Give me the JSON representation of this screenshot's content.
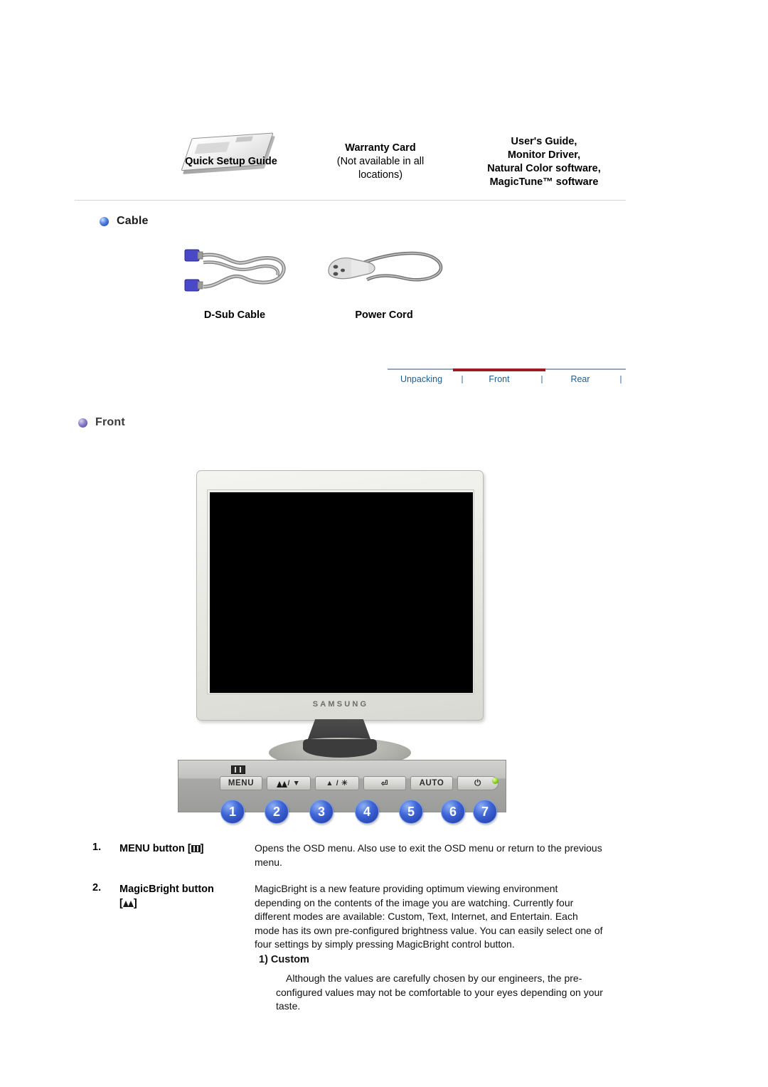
{
  "accessories": {
    "items": [
      {
        "caption": "Quick Setup Guide",
        "icon": "booklet-icon"
      },
      {
        "caption_line1": "Warranty Card",
        "caption_line2": "(Not available in all",
        "caption_line3": "locations)"
      },
      {
        "line1": "User's Guide,",
        "line2": "Monitor Driver,",
        "line3": "Natural Color software,",
        "line4": "MagicTune™ software"
      }
    ]
  },
  "cable_section": {
    "heading": "Cable",
    "bullet_color": "#3d64d6",
    "items": [
      {
        "caption": "D-Sub Cable",
        "icon": "dsub-cable-icon"
      },
      {
        "caption": "Power Cord",
        "icon": "power-cord-icon"
      }
    ]
  },
  "nav": {
    "active_color": "#9c1b20",
    "line_color": "#8fa6c4",
    "tabs": [
      {
        "label": "Unpacking",
        "active": false
      },
      {
        "label": "Front",
        "active": true
      },
      {
        "label": "Rear",
        "active": false
      }
    ]
  },
  "front_section": {
    "heading": "Front",
    "bullet_color": "#8a7fc8",
    "monitor": {
      "brand": "SAMSUNG"
    },
    "control_panel": {
      "buttons": [
        {
          "n": "1",
          "label": "MENU"
        },
        {
          "n": "2",
          "label": "/ ▼"
        },
        {
          "n": "3",
          "label": "▲ / ☀"
        },
        {
          "n": "4",
          "label": "⏎"
        },
        {
          "n": "5",
          "label": "AUTO"
        },
        {
          "n": "6",
          "label": "⏻"
        },
        {
          "n": "7",
          "label": ""
        }
      ],
      "numbers": [
        "1",
        "2",
        "3",
        "4",
        "5",
        "6",
        "7"
      ],
      "led_color": "#7fc61b"
    },
    "descriptions": [
      {
        "number": "1.",
        "label_prefix": "MENU button [",
        "label_suffix": "]",
        "glyph": "menu-glyph",
        "body": "Opens the OSD menu. Also use to exit the OSD menu or return to the previous menu."
      },
      {
        "number": "2.",
        "label_prefix": "MagicBright button",
        "label_bracket_open": "[",
        "label_suffix": "]",
        "glyph": "magicbright-glyph",
        "body": "MagicBright is a new feature providing optimum viewing environment depending on the contents of the image you are watching. Currently four different modes are available: Custom, Text, Internet, and Entertain. Each mode has its own pre-configured brightness value. You can easily select one of four settings by simply pressing MagicBright control button.",
        "sub_title": "1) Custom",
        "sub_body": "Although the values are carefully chosen by our engineers, the pre-configured values may not be comfortable to your eyes depending on your taste."
      }
    ]
  }
}
